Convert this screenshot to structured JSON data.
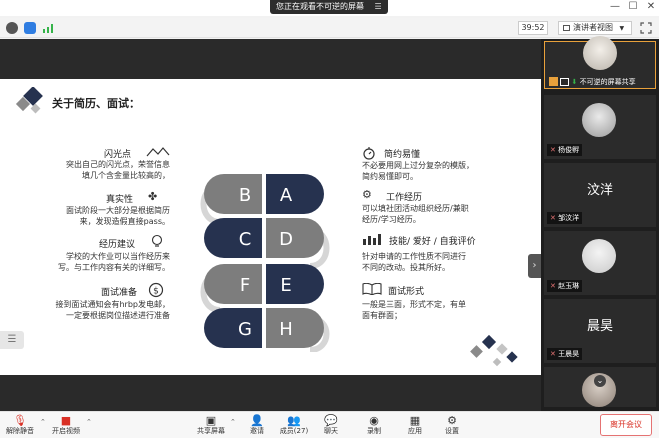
{
  "share_banner": {
    "text": "您正在观看不可逆的屏幕",
    "menu_icon": "hamburger-icon"
  },
  "toolbar": {
    "timer": "39:52",
    "view_mode": "演讲者视图"
  },
  "slide": {
    "title": "关于简历、面试：",
    "left_items": [
      {
        "label": "闪光点",
        "desc1": "突出自己的闪光点，荣誉信息",
        "desc2": "填几个含金量比较高的，"
      },
      {
        "label": "真实性",
        "desc1": "面试阶段一大部分是根据简历",
        "desc2": "来，发现造假直接pass。"
      },
      {
        "label": "经历建议",
        "desc1": "学校的大作业可以当作经历来",
        "desc2": "写。与工作内容有关的详细写。"
      },
      {
        "label": "面试准备",
        "desc1": "接到面试通知会有hrbp发电邮，",
        "desc2": "一定要根据岗位描述进行准备"
      }
    ],
    "right_items": [
      {
        "label": "简约易懂",
        "desc1": "不必要用网上过分复杂的模版，",
        "desc2": "简约易懂即可。"
      },
      {
        "label": "工作经历",
        "desc1": "可以填社团活动组织经历/兼职",
        "desc2": "经历/学习经历。"
      },
      {
        "label": "技能/ 爱好 / 自我评价",
        "desc1": "针对申请的工作性质不同进行",
        "desc2": "不同的改动。投其所好。"
      },
      {
        "label": "面试形式",
        "desc1": "一般是三面，形式不定，有单",
        "desc2": "面有群面；"
      }
    ],
    "letters": [
      "B",
      "A",
      "C",
      "D",
      "F",
      "E",
      "G",
      "H"
    ]
  },
  "participants": [
    {
      "name": "不可逆的屏幕共享",
      "type": "avatar"
    },
    {
      "name": "杨俊孵",
      "type": "avatar"
    },
    {
      "name": "邹汶洋",
      "type": "text",
      "big": "汶洋"
    },
    {
      "name": "赵玉琳",
      "type": "avatar"
    },
    {
      "name": "王晨昊",
      "type": "text",
      "big": "晨昊"
    }
  ],
  "bottom": {
    "mute": "解除静音",
    "video": "开启视频",
    "share": "共享屏幕",
    "invite": "邀请",
    "members": "成员(27)",
    "chat": "聊天",
    "record": "录制",
    "apps": "应用",
    "settings": "设置",
    "leave": "离开会议"
  },
  "colors": {
    "accent": "#e9a13b",
    "navy": "#26324f",
    "gray": "#7d7d7d",
    "leave": "#d93025"
  }
}
